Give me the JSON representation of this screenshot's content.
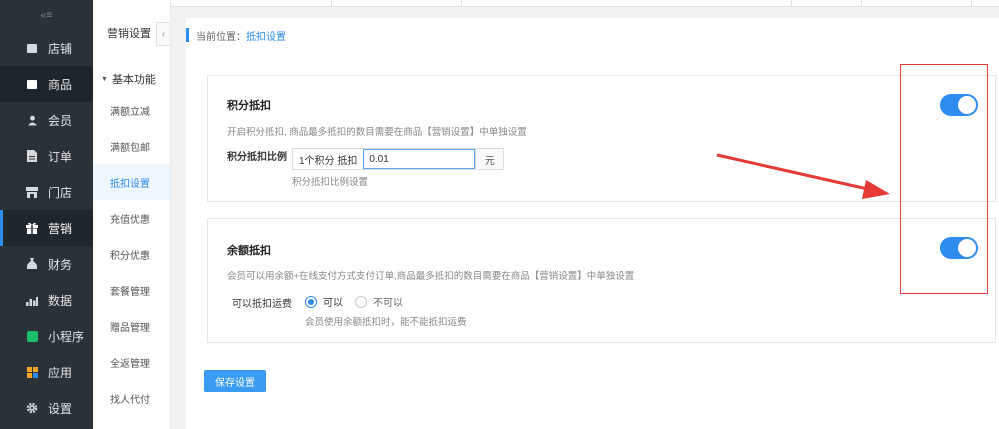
{
  "nav": {
    "toggle_glyph": "«≡",
    "items": [
      {
        "label": "店铺",
        "icon": "store-icon"
      },
      {
        "label": "商品",
        "icon": "goods-icon"
      },
      {
        "label": "会员",
        "icon": "member-icon"
      },
      {
        "label": "订单",
        "icon": "order-icon"
      },
      {
        "label": "门店",
        "icon": "shop-icon"
      },
      {
        "label": "营销",
        "icon": "marketing-icon"
      },
      {
        "label": "财务",
        "icon": "finance-icon"
      },
      {
        "label": "数据",
        "icon": "data-icon"
      },
      {
        "label": "小程序",
        "icon": "miniprogram-icon"
      },
      {
        "label": "应用",
        "icon": "apps-icon"
      },
      {
        "label": "设置",
        "icon": "settings-icon"
      }
    ],
    "active_index": 5
  },
  "subnav": {
    "title": "营销设置",
    "collapse_glyph": "‹",
    "group": "基本功能",
    "items": [
      "满额立减",
      "满额包邮",
      "抵扣设置",
      "充值优惠",
      "积分优惠",
      "套餐管理",
      "赠品管理",
      "全返管理",
      "找人代付"
    ],
    "active_index": 2
  },
  "breadcrumb": {
    "prefix": "当前位置：",
    "current": "抵扣设置"
  },
  "points_card": {
    "title": "积分抵扣",
    "desc": "开启积分抵扣, 商品最多抵扣的数目需要在商品【营销设置】中单独设置",
    "ratio_label": "积分抵扣比例",
    "ratio_prefix": "1个积分 抵扣",
    "ratio_value": "0.01",
    "ratio_suffix": "元",
    "ratio_help": "积分抵扣比例设置",
    "enabled": true
  },
  "balance_card": {
    "title": "余额抵扣",
    "desc": "会员可以用余额+在线支付方式支付订单,商品最多抵扣的数目需要在商品【营销设置】中单独设置",
    "shipping_label": "可以抵扣运费",
    "option_yes": "可以",
    "option_no": "不可以",
    "selected": "可以",
    "help": "会员使用余额抵扣时，能不能抵扣运费",
    "enabled": true
  },
  "actions": {
    "save_label": "保存设置"
  },
  "colors": {
    "accent": "#2d8cf0",
    "nav_bg": "#2a3238",
    "annotation": "#e53935"
  }
}
